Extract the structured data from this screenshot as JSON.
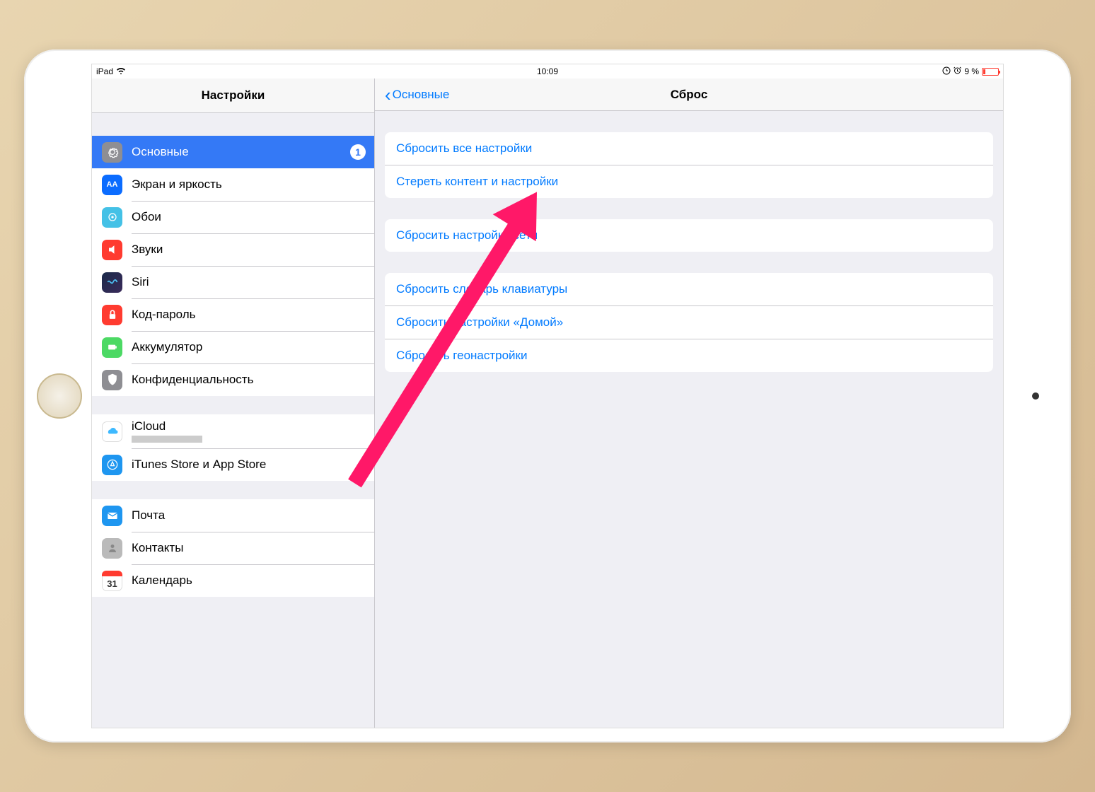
{
  "status_bar": {
    "device": "iPad",
    "time": "10:09",
    "battery_text": "9 %"
  },
  "sidebar": {
    "title": "Настройки",
    "groups": [
      [
        {
          "label": "Основные",
          "icon": "gear",
          "badge": "1",
          "active": true
        },
        {
          "label": "Экран и яркость",
          "icon": "display"
        },
        {
          "label": "Обои",
          "icon": "wallpaper"
        },
        {
          "label": "Звуки",
          "icon": "sound"
        },
        {
          "label": "Siri",
          "icon": "siri"
        },
        {
          "label": "Код-пароль",
          "icon": "passcode"
        },
        {
          "label": "Аккумулятор",
          "icon": "battery"
        },
        {
          "label": "Конфиденциальность",
          "icon": "privacy"
        }
      ],
      [
        {
          "label": "iCloud",
          "icon": "icloud",
          "sub_masked": true
        },
        {
          "label": "iTunes Store и App Store",
          "icon": "appstore"
        }
      ],
      [
        {
          "label": "Почта",
          "icon": "mail"
        },
        {
          "label": "Контакты",
          "icon": "contacts"
        },
        {
          "label": "Календарь",
          "icon": "calendar"
        }
      ]
    ]
  },
  "detail": {
    "back_label": "Основные",
    "title": "Сброс",
    "groups": [
      [
        "Сбросить все настройки",
        "Стереть контент и настройки"
      ],
      [
        "Сбросить настройки сети"
      ],
      [
        "Сбросить словарь клавиатуры",
        "Сбросить настройки «Домой»",
        "Сбросить геонастройки"
      ]
    ]
  }
}
